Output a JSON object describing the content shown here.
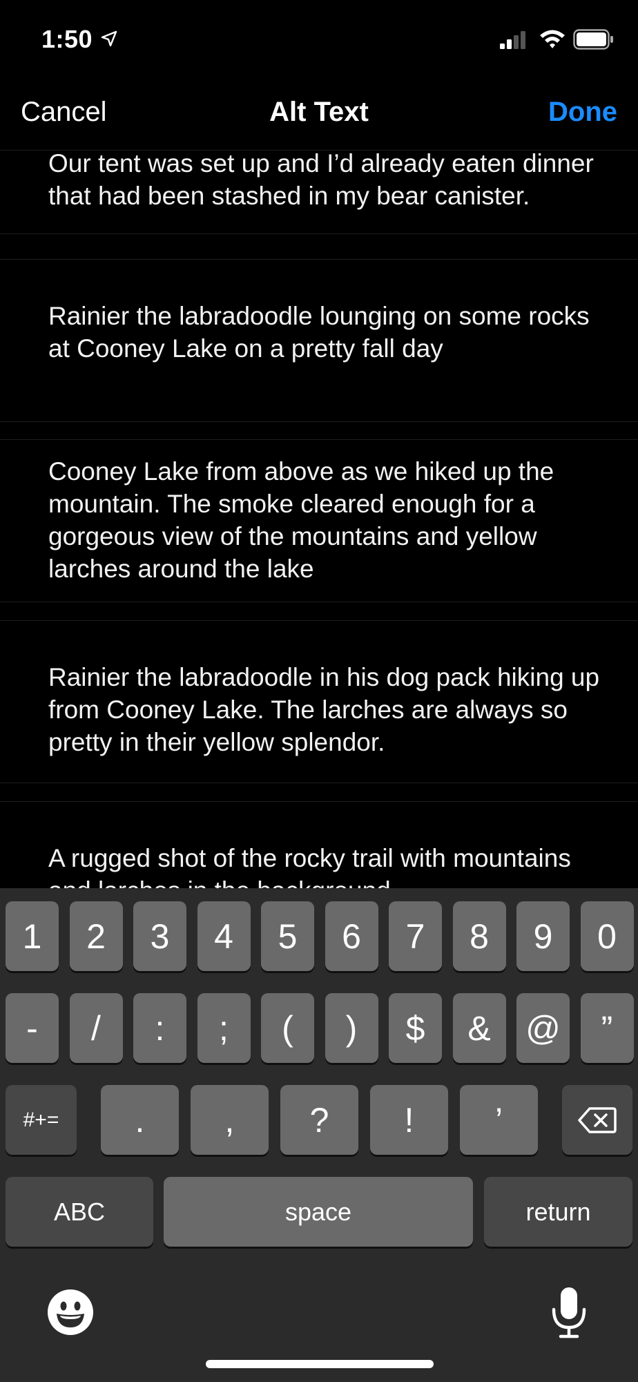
{
  "status_bar": {
    "time": "1:50",
    "icons": [
      "location-arrow-icon",
      "cellular-signal-icon",
      "wifi-icon",
      "battery-icon"
    ]
  },
  "nav": {
    "cancel_label": "Cancel",
    "title": "Alt Text",
    "done_label": "Done",
    "done_color": "#1a8cff"
  },
  "alt_items": [
    {
      "text": "Our tent was set up and I’d already eaten dinner that had been stashed in my bear canister."
    },
    {
      "text": "Rainier the labradoodle lounging on some rocks at Cooney Lake on a pretty fall day"
    },
    {
      "text": "Cooney Lake from above as we hiked up the mountain. The smoke cleared enough for a gorgeous view of the mountains and yellow larches around the lake"
    },
    {
      "text": "Rainier the labradoodle in his dog pack hiking up from Cooney Lake. The larches are always so pretty in their yellow splendor."
    },
    {
      "text": "A rugged shot of the rocky trail with mountains and larches in the background"
    }
  ],
  "keyboard": {
    "row1": [
      "1",
      "2",
      "3",
      "4",
      "5",
      "6",
      "7",
      "8",
      "9",
      "0"
    ],
    "row2": [
      "-",
      "/",
      ":",
      ";",
      "(",
      ")",
      "$",
      "&",
      "@",
      "”"
    ],
    "row3_left": "#+=",
    "row3": [
      ".",
      ",",
      "?",
      "!",
      "’"
    ],
    "row3_right_icon": "delete-backspace-icon",
    "abc_label": "ABC",
    "space_label": "space",
    "return_label": "return",
    "bottom_icons": [
      "emoji-icon",
      "microphone-icon"
    ]
  }
}
